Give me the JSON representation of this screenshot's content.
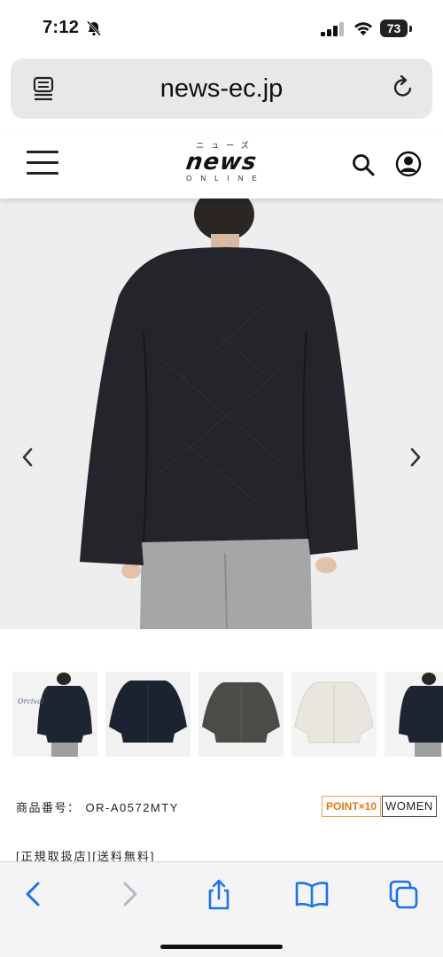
{
  "status_bar": {
    "time": "7:12",
    "battery": "73"
  },
  "browser": {
    "url": "news-ec.jp",
    "accent_color": "#1a73e8"
  },
  "site": {
    "logo_kana": "ニューズ",
    "logo_main": "news",
    "logo_sub": "ONLINE"
  },
  "product": {
    "number_label": "商品番号：",
    "number_value": "OR-A0572MTY",
    "point_badge": "POINT×10",
    "women_badge": "WOMEN",
    "tags": "[正規取扱店][送料無料]",
    "thumbnails": [
      {
        "color": "#1e2430"
      },
      {
        "color": "#1c2230"
      },
      {
        "color": "#4a4d45"
      },
      {
        "color": "#e9e6e0"
      },
      {
        "color": "#1e2430"
      }
    ]
  },
  "icons": {
    "bell": "bell-muted-icon",
    "menu": "hamburger-menu-icon",
    "search": "search-icon",
    "account": "account-icon",
    "reader": "reader-icon",
    "reload": "reload-icon"
  }
}
